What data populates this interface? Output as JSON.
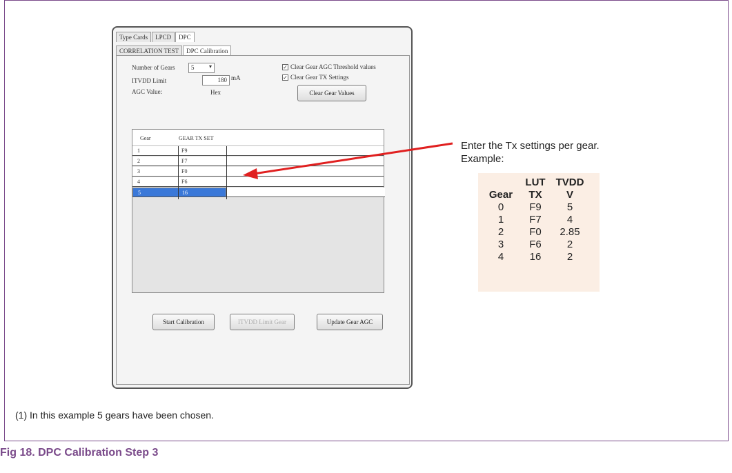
{
  "window": {
    "tabs": [
      "Type Cards",
      "LPCD",
      "DPC"
    ],
    "subtabs": [
      "CORRELATION TEST",
      "DPC Calibration"
    ],
    "gears_label": "Number of Gears",
    "gears_value": "5",
    "itvdd_label": "ITVDD Limit",
    "itvdd_value": "180",
    "itvdd_unit": "mA",
    "agc_label": "AGC Value:",
    "agc_unit": "Hex",
    "chk1": "Clear Gear AGC Threshold values",
    "chk2": "Clear Gear TX Settings",
    "clear_btn": "Clear Gear Values",
    "grid_headers": [
      "Gear",
      "GEAR TX SET"
    ],
    "grid_rows": [
      {
        "gear": "1",
        "tx": "F9"
      },
      {
        "gear": "2",
        "tx": "F7"
      },
      {
        "gear": "3",
        "tx": "F0"
      },
      {
        "gear": "4",
        "tx": "F6"
      },
      {
        "gear": "5",
        "tx": "16"
      }
    ],
    "start_btn": "Start Calibration",
    "itvdd_btn": "ITVDD Limit Gear",
    "update_btn": "Update Gear AGC"
  },
  "annotation": {
    "line1": "Enter the Tx settings per gear.",
    "line2": "Example:"
  },
  "lut": {
    "headers_top": [
      "",
      "LUT",
      "TVDD"
    ],
    "headers": [
      "Gear",
      "TX",
      "V"
    ],
    "rows": [
      [
        "0",
        "F9",
        "5"
      ],
      [
        "1",
        "F7",
        "4"
      ],
      [
        "2",
        "F0",
        "2.85"
      ],
      [
        "3",
        "F6",
        "2"
      ],
      [
        "4",
        "16",
        "2"
      ]
    ]
  },
  "caption": "(1)  In this example 5 gears have been chosen.",
  "figure_title": "Fig 18.   DPC Calibration Step 3",
  "colors": {
    "accent": "#7a4a8a",
    "arrow": "#e02020",
    "selection": "#3a78d8"
  }
}
